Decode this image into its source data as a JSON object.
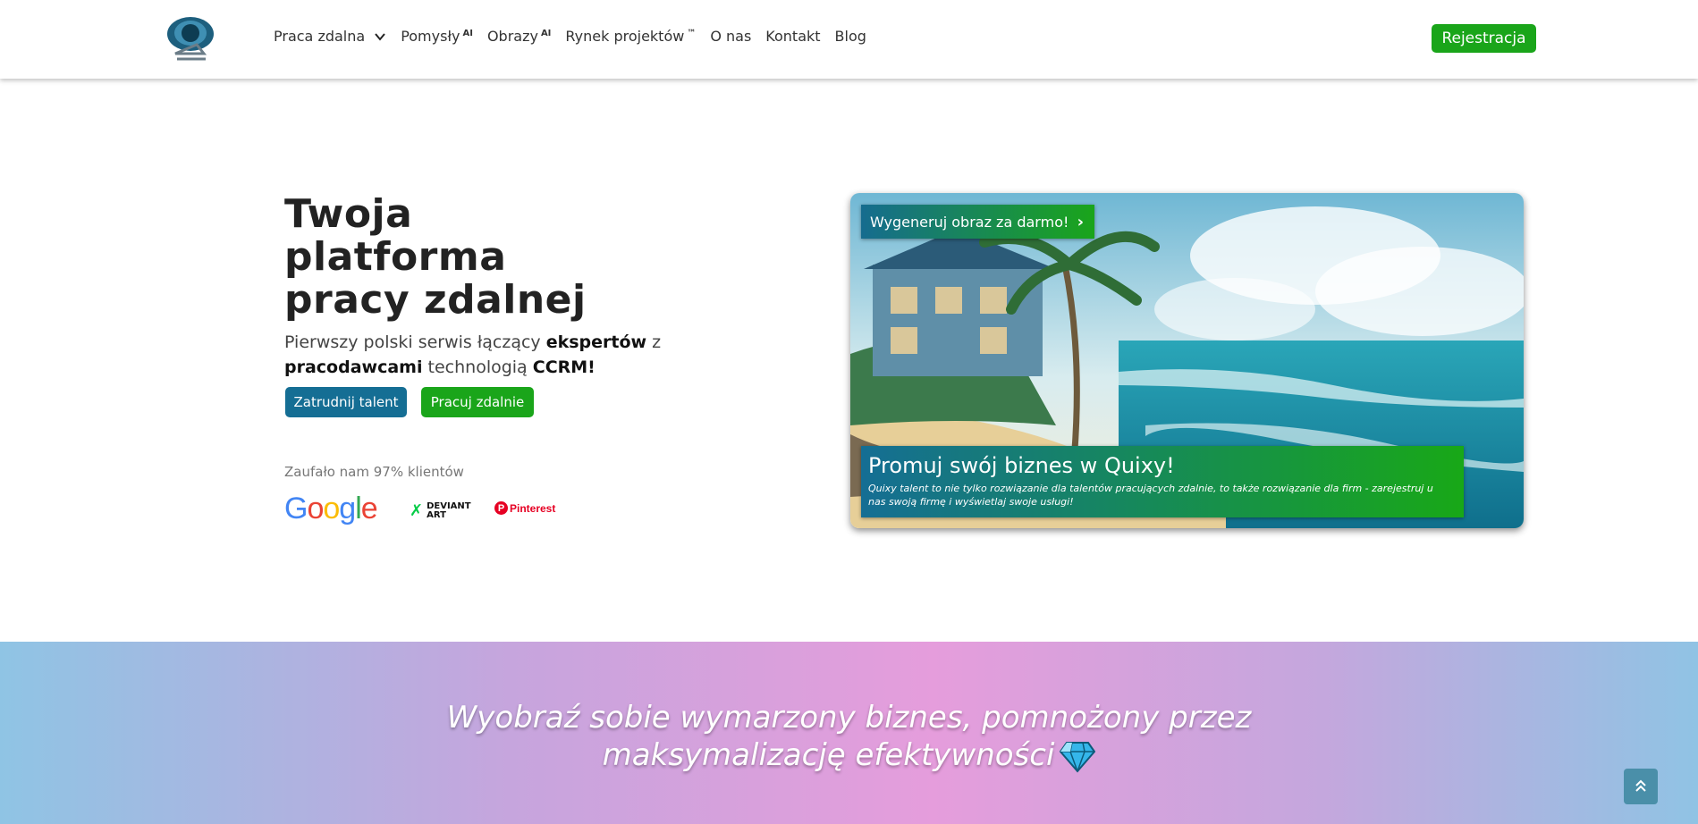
{
  "header": {
    "nav": [
      {
        "label": "Praca zdalna",
        "badge": "",
        "has_dropdown": true
      },
      {
        "label": "Pomysły",
        "badge": "AI"
      },
      {
        "label": "Obrazy",
        "badge": "AI"
      },
      {
        "label": "Rynek projektów",
        "badge": "™"
      },
      {
        "label": "O nas",
        "badge": ""
      },
      {
        "label": "Kontakt",
        "badge": ""
      },
      {
        "label": "Blog",
        "badge": ""
      }
    ],
    "register_label": "Rejestracja"
  },
  "hero": {
    "title_lines": [
      "Twoja",
      "platforma",
      "pracy zdalnej"
    ],
    "subtitle": {
      "p1": "Pierwszy polski serwis łączący ",
      "b1": "ekspertów",
      "p2": " z ",
      "b2": "pracodawcami",
      "p3": " technologią ",
      "b3": "CCRM!"
    },
    "hire_label": "Zatrudnij talent",
    "work_label": "Pracuj zdalnie",
    "trust_text": "Zaufało nam 97% klientów",
    "partners": {
      "google": "Google",
      "deviant_line1": "DEVIANT",
      "deviant_line2": "ART",
      "pinterest": "Pinterest"
    }
  },
  "promo_card": {
    "generate_label": "Wygeneruj obraz za darmo!",
    "title": "Promuj swój biznes w Quixy!",
    "text": "Quixy talent to nie tylko rozwiązanie dla talentów pracujących zdalnie, to także rozwiązanie dla firm - zarejestruj u nas swoją firmę i wyświetlaj swoje usługi!"
  },
  "band": {
    "line1": "Wyobraź sobie wymarzony biznes, pomnożony przez",
    "line2": "maksymalizację efektywności"
  },
  "colors": {
    "green": "#1aa51a",
    "blue": "#156e94",
    "scroll_button": "#4a8fa9"
  },
  "icons": [
    "logo-icon",
    "chevron-down-icon",
    "chevron-right-icon",
    "gem-icon",
    "scroll-top-icon"
  ]
}
